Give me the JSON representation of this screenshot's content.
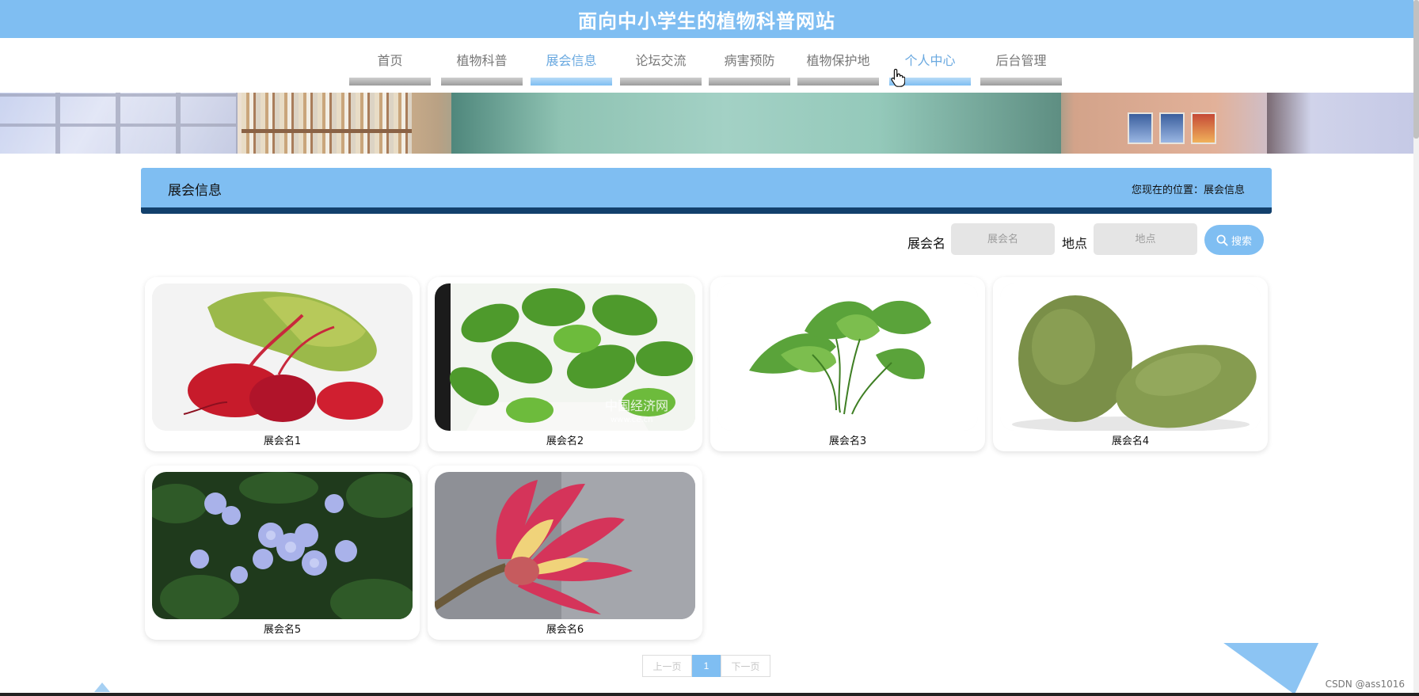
{
  "header": {
    "site_title": "面向中小学生的植物科普网站"
  },
  "nav": {
    "items": [
      {
        "label": "首页",
        "active": false
      },
      {
        "label": "植物科普",
        "active": false
      },
      {
        "label": "展会信息",
        "active": true
      },
      {
        "label": "论坛交流",
        "active": false
      },
      {
        "label": "病害预防",
        "active": false
      },
      {
        "label": "植物保护地",
        "active": false
      },
      {
        "label": "个人中心",
        "active": true
      },
      {
        "label": "后台管理",
        "active": false
      }
    ]
  },
  "section": {
    "title": "展会信息",
    "breadcrumb": "您现在的位置：展会信息"
  },
  "search": {
    "name_label": "展会名",
    "name_placeholder": "展会名",
    "location_label": "地点",
    "location_placeholder": "地点",
    "button_label": "搜索"
  },
  "cards": [
    {
      "name": "展会名1",
      "image": "beetroot"
    },
    {
      "name": "展会名2",
      "image": "pothos-plant",
      "overlay": "中国经济网",
      "overlay_url": "www.ce.cn"
    },
    {
      "name": "展会名3",
      "image": "sweet-potato-leaves"
    },
    {
      "name": "展会名4",
      "image": "winter-melon"
    },
    {
      "name": "展会名5",
      "image": "blue-plumbago-flowers"
    },
    {
      "name": "展会名6",
      "image": "protea-flower"
    }
  ],
  "pagination": {
    "prev_label": "上一页",
    "current_page": "1",
    "next_label": "下一页"
  },
  "watermark": "CSDN @ass1016",
  "colors": {
    "primary": "#7fbef2",
    "dark_accent": "#12406c"
  }
}
